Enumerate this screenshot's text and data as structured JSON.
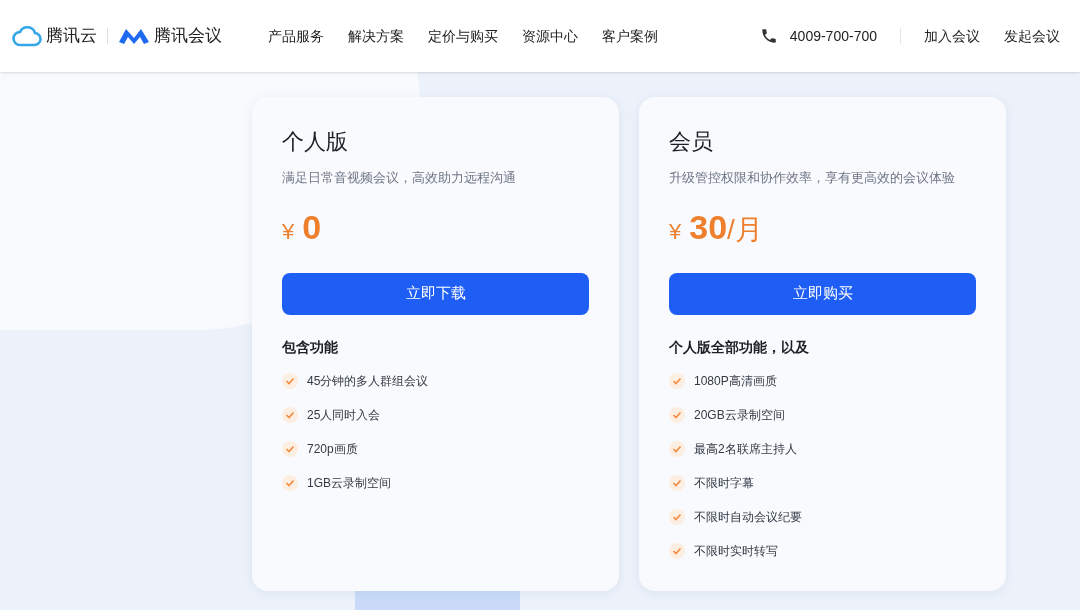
{
  "header": {
    "brand": "腾讯云",
    "product": "腾讯会议",
    "nav": [
      {
        "label": "产品服务"
      },
      {
        "label": "解决方案"
      },
      {
        "label": "定价与购买"
      },
      {
        "label": "资源中心"
      },
      {
        "label": "客户案例"
      }
    ],
    "phone": "4009-700-700",
    "actions": [
      {
        "label": "加入会议"
      },
      {
        "label": "发起会议"
      }
    ]
  },
  "plans": [
    {
      "name": "个人版",
      "subtitle": "满足日常音视频会议，高效助力远程沟通",
      "currency": "¥",
      "amount": "0",
      "button": "立即下载",
      "features_title": "包含功能",
      "features": [
        "45分钟的多人群组会议",
        "25人同时入会",
        "720p画质",
        "1GB云录制空间"
      ]
    },
    {
      "name": "会员",
      "subtitle": "升级管控权限和协作效率，享有更高效的会议体验",
      "currency": "¥",
      "amount": "30",
      "unit": "/月",
      "button": "立即购买",
      "features_title": "个人版全部功能，以及",
      "features": [
        "1080P高清画质",
        "20GB云录制空间",
        "最高2名联席主持人",
        "不限时字幕",
        "不限时自动会议纪要",
        "不限时实时转写"
      ]
    }
  ]
}
